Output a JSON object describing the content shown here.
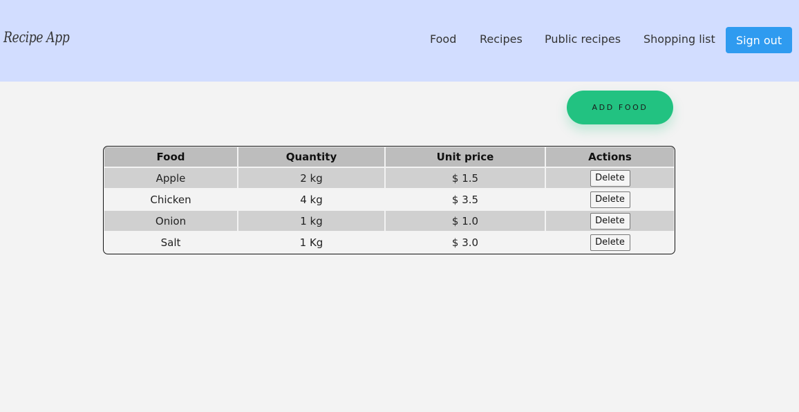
{
  "app": {
    "title": "Recipe App"
  },
  "nav": {
    "links": [
      {
        "label": "Food"
      },
      {
        "label": "Recipes"
      },
      {
        "label": "Public recipes"
      },
      {
        "label": "Shopping list"
      }
    ],
    "signout_label": "Sign out"
  },
  "actions": {
    "add_food_label": "ADD FOOD"
  },
  "table": {
    "headers": [
      "Food",
      "Quantity",
      "Unit price",
      "Actions"
    ],
    "rows": [
      {
        "food": "Apple",
        "quantity": "2 kg",
        "price": "$ 1.5",
        "action": "Delete"
      },
      {
        "food": "Chicken",
        "quantity": "4 kg",
        "price": "$ 3.5",
        "action": "Delete"
      },
      {
        "food": "Onion",
        "quantity": "1 kg",
        "price": "$ 1.0",
        "action": "Delete"
      },
      {
        "food": "Salt",
        "quantity": "1 Kg",
        "price": "$ 3.0",
        "action": "Delete"
      }
    ]
  },
  "colors": {
    "navbar_bg": "#d2ddff",
    "signout_bg": "#2f9bf0",
    "add_food_bg": "#22c281",
    "page_bg": "#f3f3f3"
  }
}
